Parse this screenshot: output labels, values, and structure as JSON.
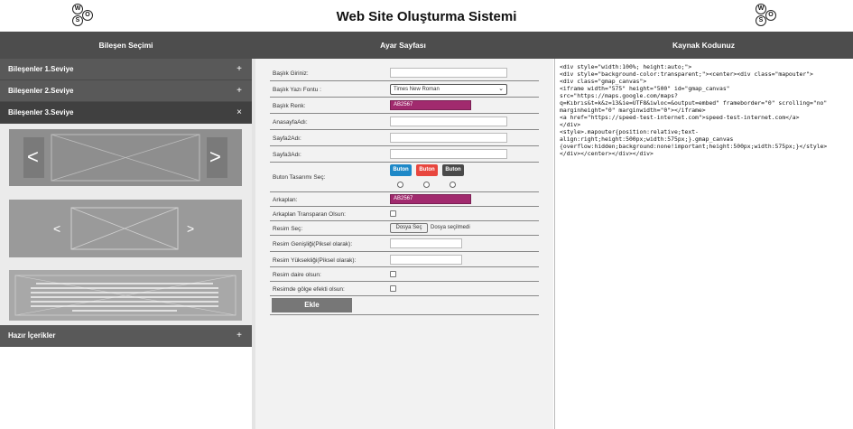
{
  "header": {
    "title": "Web Site Oluşturma Sistemi",
    "logo_letters": [
      "W",
      "S",
      "O"
    ]
  },
  "columns": {
    "left_title": "Bileşen Seçimi",
    "middle_title": "Ayar Sayfası",
    "right_title": "Kaynak Kodunuz"
  },
  "accordion": {
    "level1": {
      "label": "Bileşenler 1.Seviye",
      "sign": "+"
    },
    "level2": {
      "label": "Bileşenler 2.Seviye",
      "sign": "+"
    },
    "level3": {
      "label": "Bileşenler 3.Seviye",
      "sign": "×"
    },
    "ready": {
      "label": "Hazır İçerikler",
      "sign": "+"
    },
    "thumbnails": {
      "slider1_prev": "<",
      "slider1_next": ">",
      "slider2_prev": "<",
      "slider2_next": ">"
    }
  },
  "form": {
    "title_label": "Başlık Giriniz:",
    "font_label": "Başlık Yazı Fontu :",
    "font_value": "Times New Roman",
    "color_label": "Başlık Renk:",
    "color_value": "AB2567",
    "home_label": "AnasayfaAdı:",
    "page2_label": "Sayfa2Adı:",
    "page3_label": "Sayfa3Adı:",
    "button_design_label": "Buton Tasarımı Seç:",
    "button_options": [
      {
        "label": "Buton",
        "color": "#1e88c7"
      },
      {
        "label": "Buton",
        "color": "#e8463e"
      },
      {
        "label": "Buton",
        "color": "#4a4a4a"
      }
    ],
    "bg_label": "Arkaplan:",
    "bg_value": "AB2567",
    "bg_transparent_label": "Arkaplan Transparan Olsun:",
    "image_label": "Resim Seç:",
    "file_button": "Dosya Seç",
    "file_status": "Dosya seçilmedi",
    "img_width_label": "Resim Genişliği(Piksel olarak):",
    "img_height_label": "Resim Yüksekliği(Piksel olarak):",
    "img_circle_label": "Resim daire olsun:",
    "img_shadow_label": "Resimde gölge efekti olsun:",
    "submit": "Ekle"
  },
  "source_code": "<div style=\"width:100%; height:auto;\">\n<div style=\"background-color:transparent;\"><center><div class=\"mapouter\">\n<div class=\"gmap_canvas\">\n<iframe width=\"575\" height=\"500\" id=\"gmap_canvas\"\nsrc=\"https://maps.google.com/maps?\nq=Kıbrıs&t=k&z=13&ie=UTF8&iwloc=&output=embed\" frameborder=\"0\" scrolling=\"no\"\nmarginheight=\"0\" marginwidth=\"0\"></iframe>\n<a href=\"https://speed-test-internet.com\">speed-test-internet.com</a>\n</div>\n<style>.mapouter{position:relative;text-\nalign:right;height:500px;width:575px;}.gmap_canvas\n{overflow:hidden;background:none!important;height:500px;width:575px;}</style>\n</div></center></div></div>"
}
